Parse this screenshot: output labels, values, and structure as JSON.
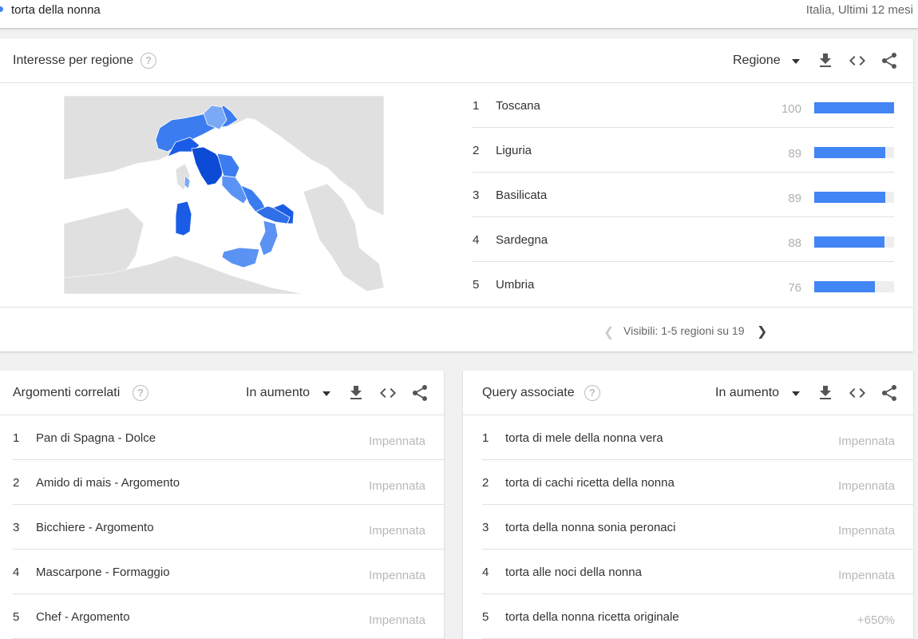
{
  "header": {
    "search_term": "torta della nonna",
    "scope": "Italia, Ultimi 12 mesi"
  },
  "region_card": {
    "title": "Interesse per regione",
    "help": "?",
    "dropdown_label": "Regione",
    "rows": [
      {
        "rank": "1",
        "name": "Toscana",
        "value": "100",
        "fraction": 1.0
      },
      {
        "rank": "2",
        "name": "Liguria",
        "value": "89",
        "fraction": 0.89
      },
      {
        "rank": "3",
        "name": "Basilicata",
        "value": "89",
        "fraction": 0.89
      },
      {
        "rank": "4",
        "name": "Sardegna",
        "value": "88",
        "fraction": 0.88
      },
      {
        "rank": "5",
        "name": "Umbria",
        "value": "76",
        "fraction": 0.76
      }
    ],
    "pager_text": "Visibili: 1-5 regioni su 19"
  },
  "topics_card": {
    "title": "Argomenti correlati",
    "help": "?",
    "dropdown_label": "In aumento",
    "rows": [
      {
        "rank": "1",
        "name": "Pan di Spagna - Dolce",
        "value": "Impennata"
      },
      {
        "rank": "2",
        "name": "Amido di mais - Argomento",
        "value": "Impennata"
      },
      {
        "rank": "3",
        "name": "Bicchiere - Argomento",
        "value": "Impennata"
      },
      {
        "rank": "4",
        "name": "Mascarpone - Formaggio",
        "value": "Impennata"
      },
      {
        "rank": "5",
        "name": "Chef - Argomento",
        "value": "Impennata"
      }
    ]
  },
  "queries_card": {
    "title": "Query associate",
    "help": "?",
    "dropdown_label": "In aumento",
    "rows": [
      {
        "rank": "1",
        "name": "torta di mele della nonna vera",
        "value": "Impennata"
      },
      {
        "rank": "2",
        "name": "torta di cachi ricetta della nonna",
        "value": "Impennata"
      },
      {
        "rank": "3",
        "name": "torta della nonna sonia peronaci",
        "value": "Impennata"
      },
      {
        "rank": "4",
        "name": "torta alle noci della nonna",
        "value": "Impennata"
      },
      {
        "rank": "5",
        "name": "torta della nonna ricetta originale",
        "value": "+650%"
      }
    ]
  },
  "colors": {
    "bar": "#4285f4",
    "map_strong": "#1a5ce6",
    "map_medium": "#3b7cf0",
    "map_light": "#7aa9f5"
  },
  "icons": [
    "download-icon",
    "embed-icon",
    "share-icon",
    "help-icon",
    "chevron-left-icon",
    "chevron-right-icon",
    "dropdown-arrow-icon"
  ]
}
